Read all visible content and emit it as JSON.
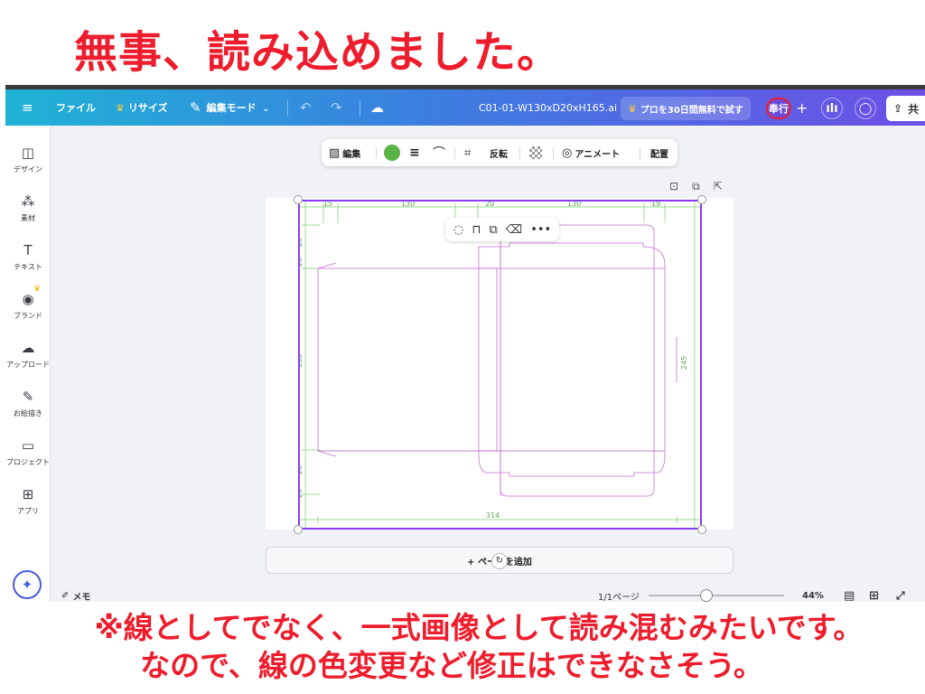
{
  "headline": "無事、読み込めました。",
  "note_lines": [
    "※線としてでなく、一式画像として読み混むみたいです。",
    "なので、線の色変更など修正はできなさそう。"
  ],
  "topbar": {
    "menu_icon": "≡",
    "file": "ファイル",
    "resize": "リサイズ",
    "edit_mode": "編集モード",
    "filename": "C01-01-W130xD20xH165.ai",
    "trial": "プロを30日間無料で試す",
    "avatar": "奉行",
    "plus": "+",
    "share": "共"
  },
  "sidebar": [
    {
      "label": "デザイン",
      "icon": "◫",
      "name": "design"
    },
    {
      "label": "素材",
      "icon": "⁂",
      "name": "elements"
    },
    {
      "label": "テキスト",
      "icon": "T",
      "name": "text"
    },
    {
      "label": "ブランド",
      "icon": "◉",
      "name": "brand"
    },
    {
      "label": "アップロード",
      "icon": "☁",
      "name": "uploads"
    },
    {
      "label": "お絵描き",
      "icon": "✎",
      "name": "draw"
    },
    {
      "label": "プロジェクト",
      "icon": "▭",
      "name": "projects"
    },
    {
      "label": "アプリ",
      "icon": "⊞",
      "name": "apps"
    }
  ],
  "context_toolbar": {
    "edit": "編集",
    "flip": "反転",
    "animate": "アニメート",
    "arrange": "配置"
  },
  "drawing": {
    "dims_top": [
      "15",
      "130",
      "20",
      "130",
      "19"
    ],
    "dims_left": [
      "20",
      "20",
      "165",
      "20",
      "20"
    ],
    "dim_right": "245",
    "dim_bottom": "314"
  },
  "add_page": "+ ページを追加",
  "bottombar": {
    "memo": "メモ",
    "page": "1/1ページ",
    "zoom": "44%",
    "zoom_fraction": 0.44
  },
  "colors": {
    "headline": "#ee1d2d",
    "die_line": "#c86bd8",
    "dimension_line": "#7ccc6a",
    "selection": "#8b3df0"
  }
}
